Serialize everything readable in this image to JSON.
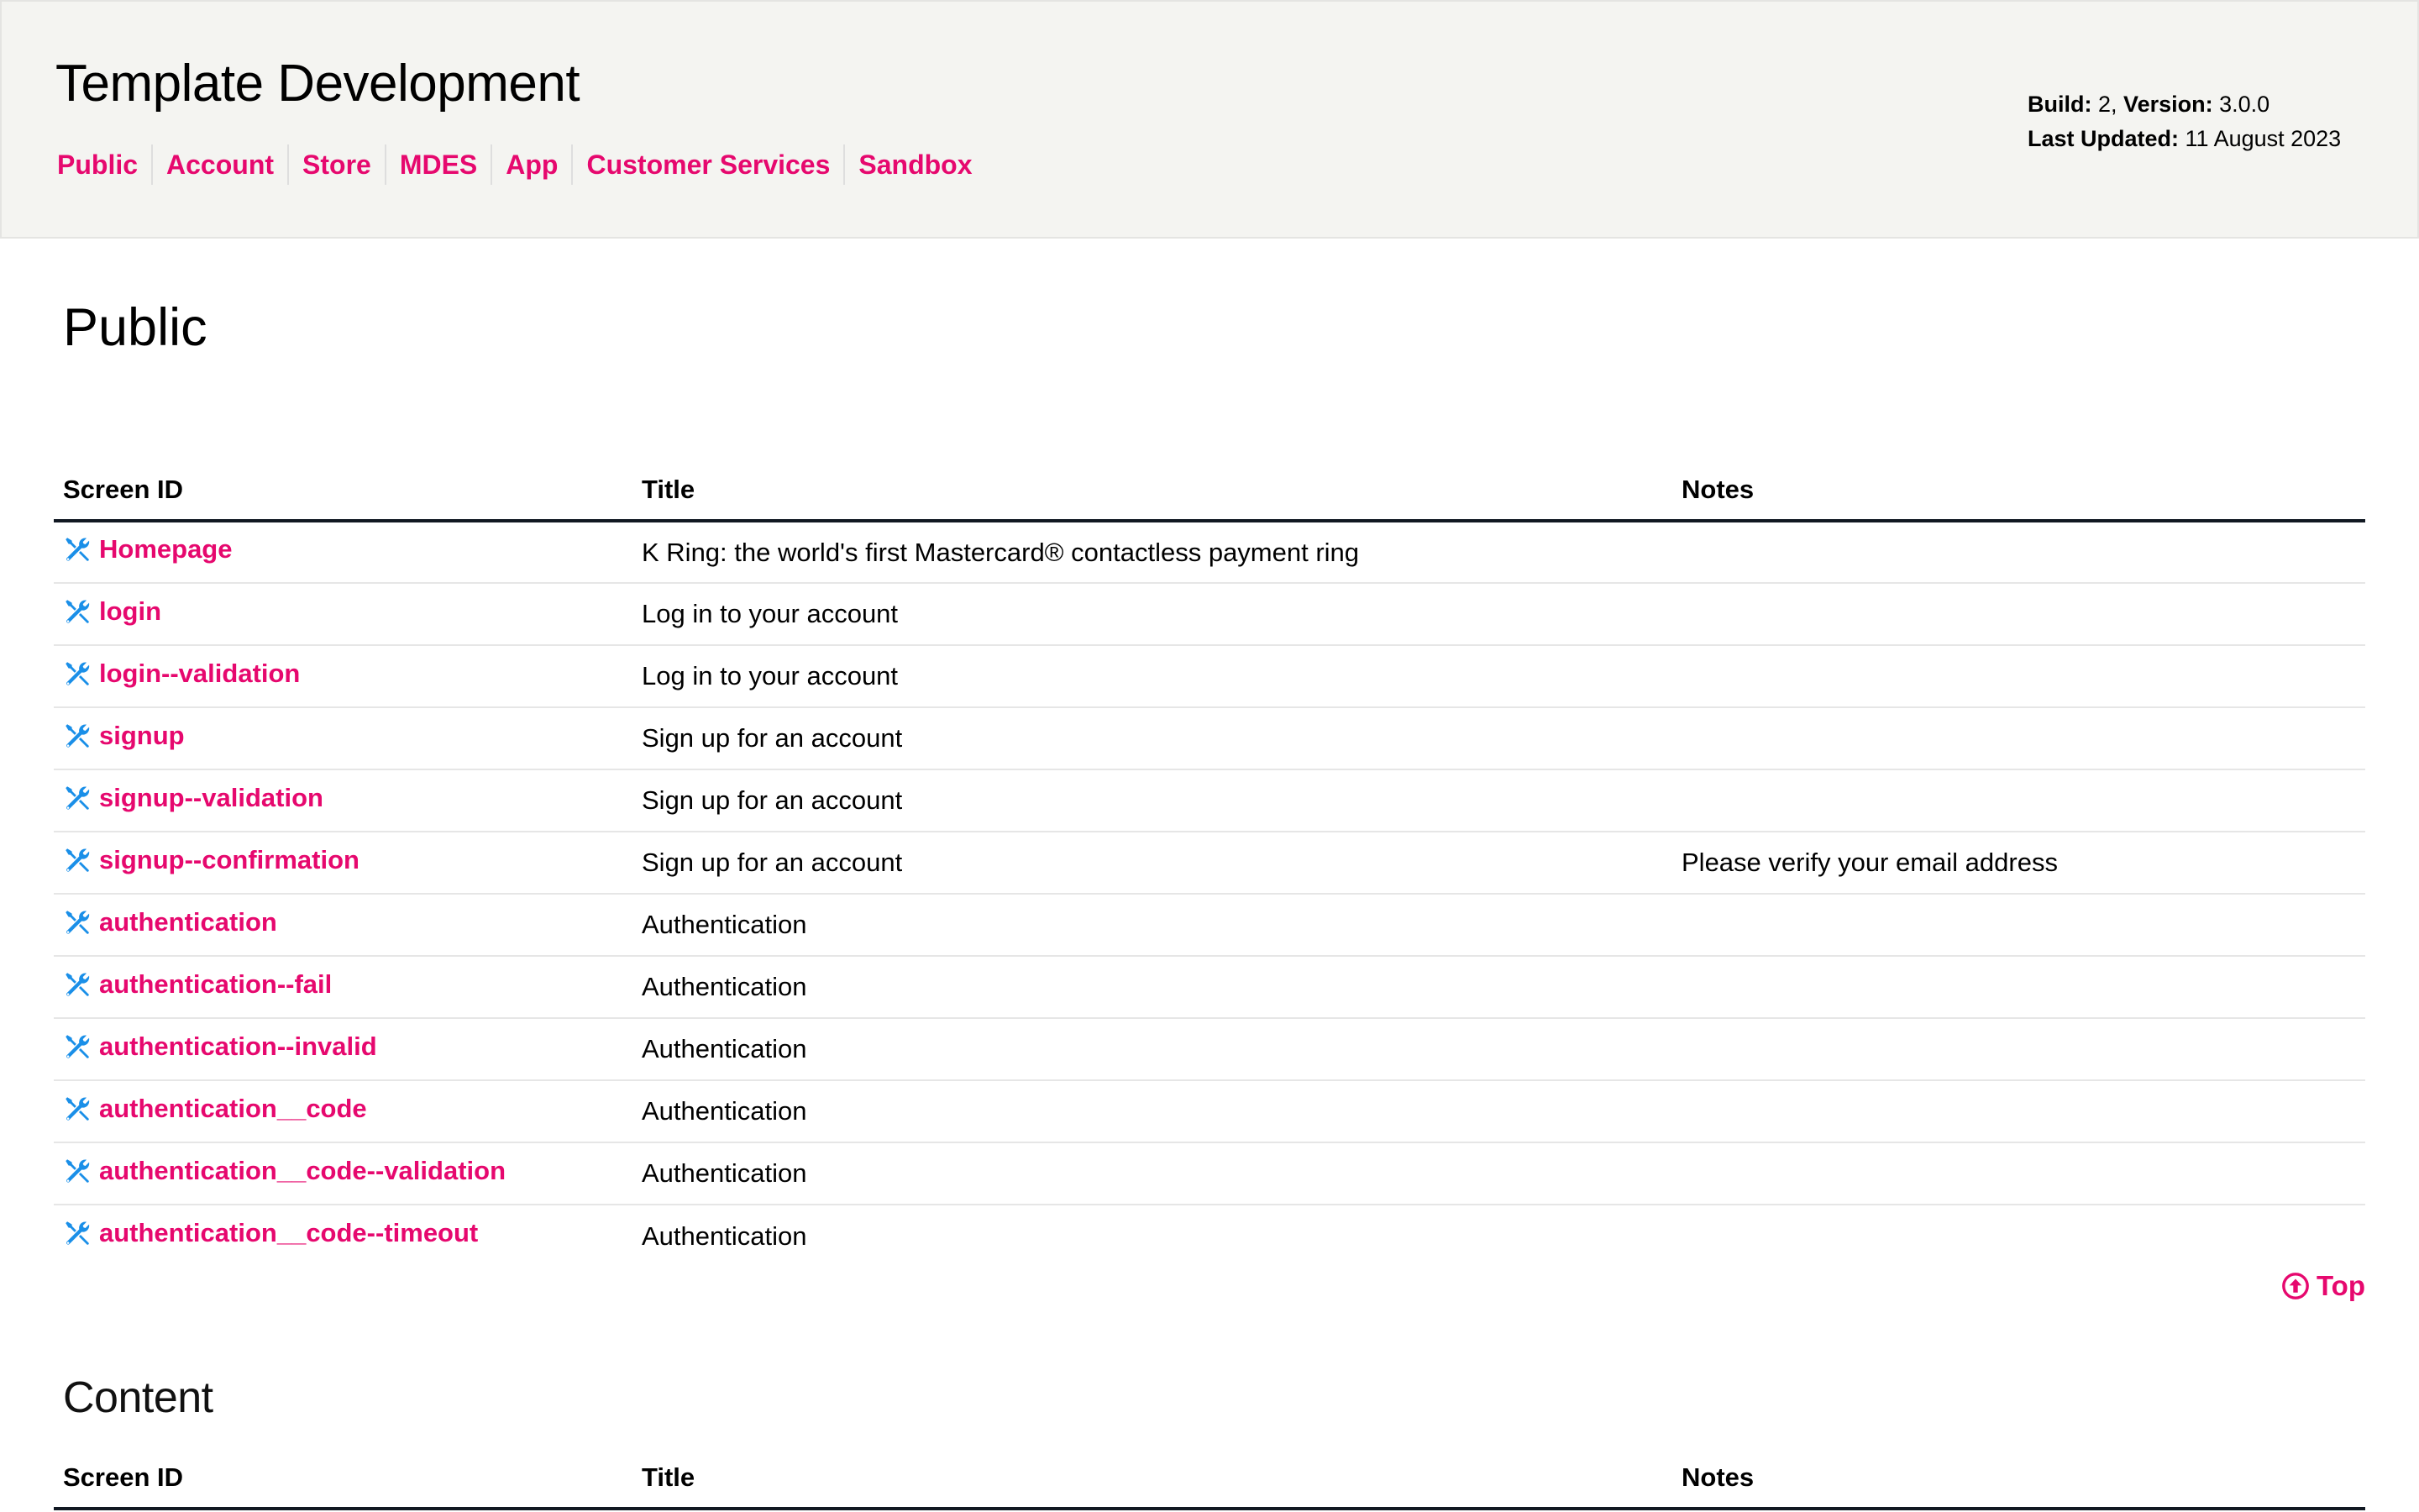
{
  "header": {
    "title": "Template Development",
    "nav": [
      {
        "label": "Public"
      },
      {
        "label": "Account"
      },
      {
        "label": "Store"
      },
      {
        "label": "MDES"
      },
      {
        "label": "App"
      },
      {
        "label": "Customer Services"
      },
      {
        "label": "Sandbox"
      }
    ],
    "build_label": "Build:",
    "build_value": "2,",
    "version_label": "Version:",
    "version_value": "3.0.0",
    "updated_label": "Last Updated:",
    "updated_value": "11 August 2023"
  },
  "colors": {
    "accent": "#e6086e",
    "icon": "#1a8fe8",
    "header_bg": "#f4f4f1",
    "table_rule": "#111822"
  },
  "columns": {
    "screen_id": "Screen ID",
    "title": "Title",
    "notes": "Notes"
  },
  "sections": [
    {
      "heading": "Public",
      "rows": [
        {
          "icon": "tools-icon",
          "id": "Homepage",
          "title": "K Ring: the world's first Mastercard® contactless payment ring",
          "notes": ""
        },
        {
          "icon": "tools-icon",
          "id": "login",
          "title": "Log in to your account",
          "notes": ""
        },
        {
          "icon": "tools-icon",
          "id": "login--validation",
          "title": "Log in to your account",
          "notes": ""
        },
        {
          "icon": "tools-icon",
          "id": "signup",
          "title": "Sign up for an account",
          "notes": ""
        },
        {
          "icon": "tools-icon",
          "id": "signup--validation",
          "title": "Sign up for an account",
          "notes": ""
        },
        {
          "icon": "tools-icon",
          "id": "signup--confirmation",
          "title": "Sign up for an account",
          "notes": "Please verify your email address"
        },
        {
          "icon": "tools-icon",
          "id": "authentication",
          "title": "Authentication",
          "notes": ""
        },
        {
          "icon": "tools-icon",
          "id": "authentication--fail",
          "title": "Authentication",
          "notes": ""
        },
        {
          "icon": "tools-icon",
          "id": "authentication--invalid",
          "title": "Authentication",
          "notes": ""
        },
        {
          "icon": "tools-icon",
          "id": "authentication__code",
          "title": "Authentication",
          "notes": ""
        },
        {
          "icon": "tools-icon",
          "id": "authentication__code--validation",
          "title": "Authentication",
          "notes": ""
        },
        {
          "icon": "tools-icon",
          "id": "authentication__code--timeout",
          "title": "Authentication",
          "notes": ""
        }
      ],
      "top_link": {
        "icon": "arrow-up-circle-icon",
        "label": "Top"
      }
    },
    {
      "heading": "Content",
      "rows": []
    }
  ]
}
